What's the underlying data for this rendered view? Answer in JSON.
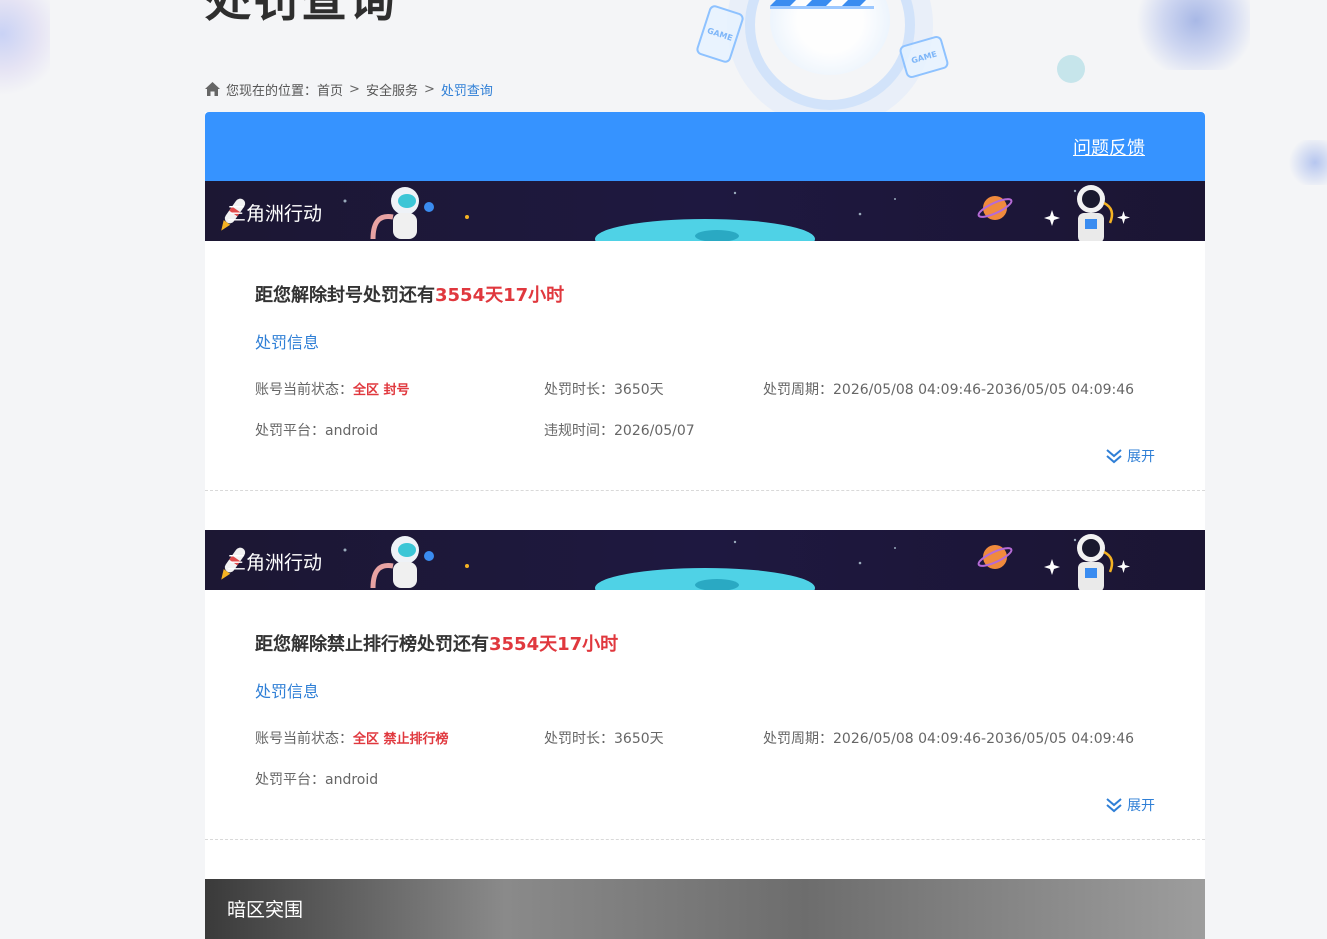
{
  "page": {
    "title": "处罚查询"
  },
  "breadcrumb": {
    "prefix": "您现在的位置：",
    "items": [
      "首页",
      "安全服务",
      "处罚查询"
    ],
    "separator": ">"
  },
  "header": {
    "feedback_label": "问题反馈"
  },
  "records": [
    {
      "game_name": "三角洲行动",
      "countdown_prefix": "距您解除封号处罚还有",
      "countdown_value": "3554天17小时",
      "section_title": "处罚信息",
      "status_label": "账号当前状态：",
      "status_value": "全区  封号",
      "duration_label": "处罚时长：",
      "duration_value": "3650天",
      "period_label": "处罚周期：",
      "period_value": "2026/05/08 04:09:46-2036/05/05 04:09:46",
      "platform_label": "处罚平台：",
      "platform_value": "android",
      "violation_label": "违规时间：",
      "violation_value": "2026/05/07",
      "expand_label": "展开"
    },
    {
      "game_name": "三角洲行动",
      "countdown_prefix": "距您解除禁止排行榜处罚还有",
      "countdown_value": "3554天17小时",
      "section_title": "处罚信息",
      "status_label": "账号当前状态：",
      "status_value": "全区  禁止排行榜",
      "duration_label": "处罚时长：",
      "duration_value": "3650天",
      "period_label": "处罚周期：",
      "period_value": "2026/05/08 04:09:46-2036/05/05 04:09:46",
      "platform_label": "处罚平台：",
      "platform_value": "android",
      "expand_label": "展开"
    }
  ],
  "bottom_record": {
    "game_name": "暗区突围"
  },
  "colors": {
    "accent": "#3693ff",
    "link": "#2f7fd6",
    "danger": "#e0383e",
    "banner_dark": "#1c1733"
  }
}
